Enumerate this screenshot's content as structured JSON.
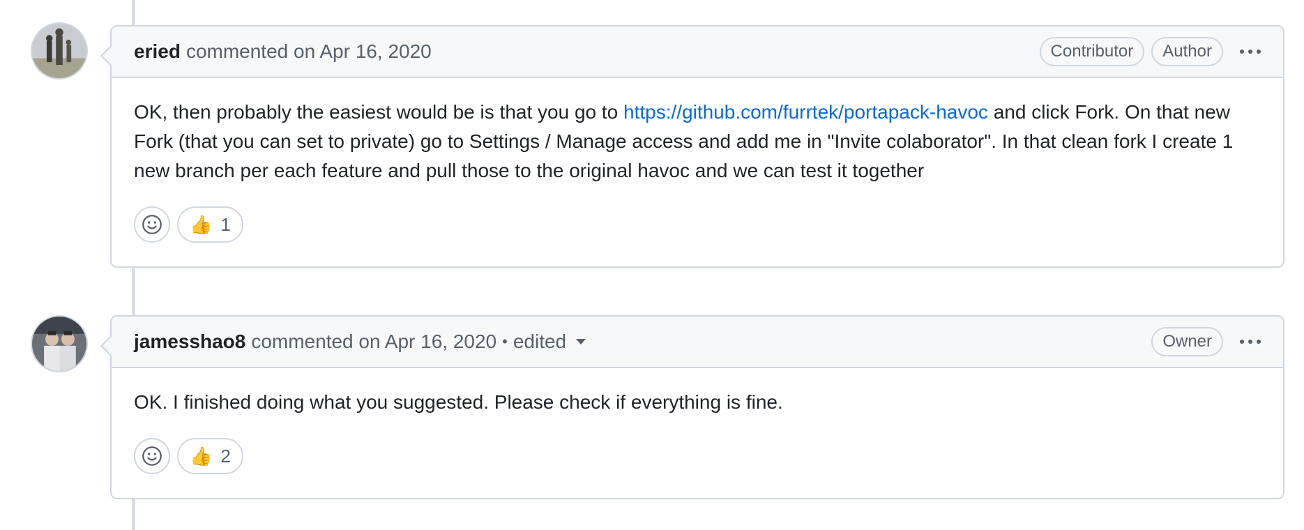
{
  "comments": [
    {
      "author": "eried",
      "action": "commented on Apr 16, 2020",
      "badges": [
        "Contributor",
        "Author"
      ],
      "body_before": "OK, then probably the easiest would be is that you go to ",
      "link": "https://github.com/furrtek/portapack-havoc",
      "body_after": " and click Fork. On that new Fork (that you can set to private) go to Settings / Manage access and add me in \"Invite colaborator\". In that clean fork I create 1 new branch per each feature and pull those to the original havoc and we can test it together",
      "reaction_emoji": "👍",
      "reaction_count": "1"
    },
    {
      "author": "jamesshao8",
      "action": "commented on Apr 16, 2020",
      "separator": "•",
      "edited": "edited",
      "badges": [
        "Owner"
      ],
      "body": "OK. I finished doing what you suggested. Please check if everything is fine.",
      "reaction_emoji": "👍",
      "reaction_count": "2"
    }
  ],
  "icons": {
    "add_reaction": "smiley-icon",
    "more_options": "kebab-horizontal-icon",
    "edited_dropdown": "triangle-down-icon"
  },
  "colors": {
    "link": "#0969da",
    "border": "#d0d7de",
    "header_bg": "#f6f8fa",
    "muted_text": "#57606a"
  }
}
